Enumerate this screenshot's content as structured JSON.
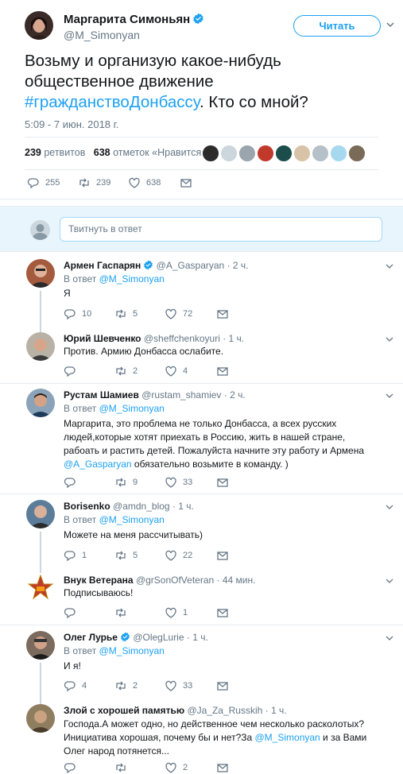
{
  "main_tweet": {
    "author_name": "Маргарита Симоньян",
    "handle": "@M_Simonyan",
    "follow_label": "Читать",
    "text_before": "Возьму и организую какое-нибудь общественное движение ",
    "hashtag": "#гражданствоДонбассу",
    "text_after": ". Кто со мной?",
    "timestamp": "5:09 - 7 июн. 2018 г.",
    "retweets_count": "239",
    "retweets_label": "ретвитов",
    "likes_count": "638",
    "likes_label": "отметок «Нравится»",
    "actions": {
      "replies": "255",
      "retweets": "239",
      "likes": "638"
    }
  },
  "compose": {
    "placeholder": "Твитнуть в ответ"
  },
  "replies": [
    {
      "name": "Армен Гаспарян",
      "verified": true,
      "handle": "@A_Gasparyan",
      "time": "· 2 ч.",
      "reply_to_label": "В ответ",
      "reply_to_handle": "@M_Simonyan",
      "text": "Я",
      "replies": "10",
      "retweets": "5",
      "likes": "72"
    },
    {
      "name": "Юрий Шевченко",
      "verified": false,
      "handle": "@sheffchenkoyuri",
      "time": "· 1 ч.",
      "text": "Против. Армию Донбасса ослабите.",
      "replies": "",
      "retweets": "2",
      "likes": "4"
    },
    {
      "name": "Рустам Шамиев",
      "verified": false,
      "handle": "@rustam_shamiev",
      "time": "· 2 ч.",
      "reply_to_label": "В ответ",
      "reply_to_handle": "@M_Simonyan",
      "text_part1": "Маргарита, это проблема не только Донбасса, а всех русских людей,которые хотят приехать в Россию, жить в нашей стране, рабоать и растить детей. Пожалуйста начните эту работу и Армена ",
      "mention": "@A_Gasparyan",
      "text_part2": " обязательно возьмите в команду. )",
      "replies": "",
      "retweets": "9",
      "likes": "33"
    },
    {
      "name": "Borisenko",
      "verified": false,
      "handle": "@amdn_blog",
      "time": "· 1 ч.",
      "reply_to_label": "В ответ",
      "reply_to_handle": "@M_Simonyan",
      "text": "Можете на меня рассчитывать)",
      "replies": "1",
      "retweets": "5",
      "likes": "22"
    },
    {
      "name": "Внук Ветерана",
      "verified": false,
      "handle": "@grSonOfVeteran",
      "time": "· 44 мин.",
      "text": "Подписываюсь!",
      "replies": "",
      "retweets": "",
      "likes": "1"
    },
    {
      "name": "Олег Лурье",
      "verified": true,
      "handle": "@OlegLurie",
      "time": "· 1 ч.",
      "reply_to_label": "В ответ",
      "reply_to_handle": "@M_Simonyan",
      "text": "И я!",
      "replies": "4",
      "retweets": "2",
      "likes": "33"
    },
    {
      "name": "Злой с хорошей памятью",
      "verified": false,
      "handle": "@Ja_Za_Russkih",
      "time": "· 1 ч.",
      "text_part1": "Господа.А может одно, но действенное чем несколько расколотых? Инициатива хорошая, почему бы и нет?За ",
      "mention": "@M_Simonyan",
      "text_part2": " и за Вами Олег народ потянется...",
      "replies": "",
      "retweets": "",
      "likes": "2"
    }
  ],
  "colors": {
    "accent": "#1da1f2",
    "secondary_text": "#657786",
    "border": "#e6ecf0"
  },
  "icons": [
    "verified-badge-icon",
    "chevron-down-icon",
    "reply-icon",
    "retweet-icon",
    "like-icon",
    "message-icon"
  ]
}
